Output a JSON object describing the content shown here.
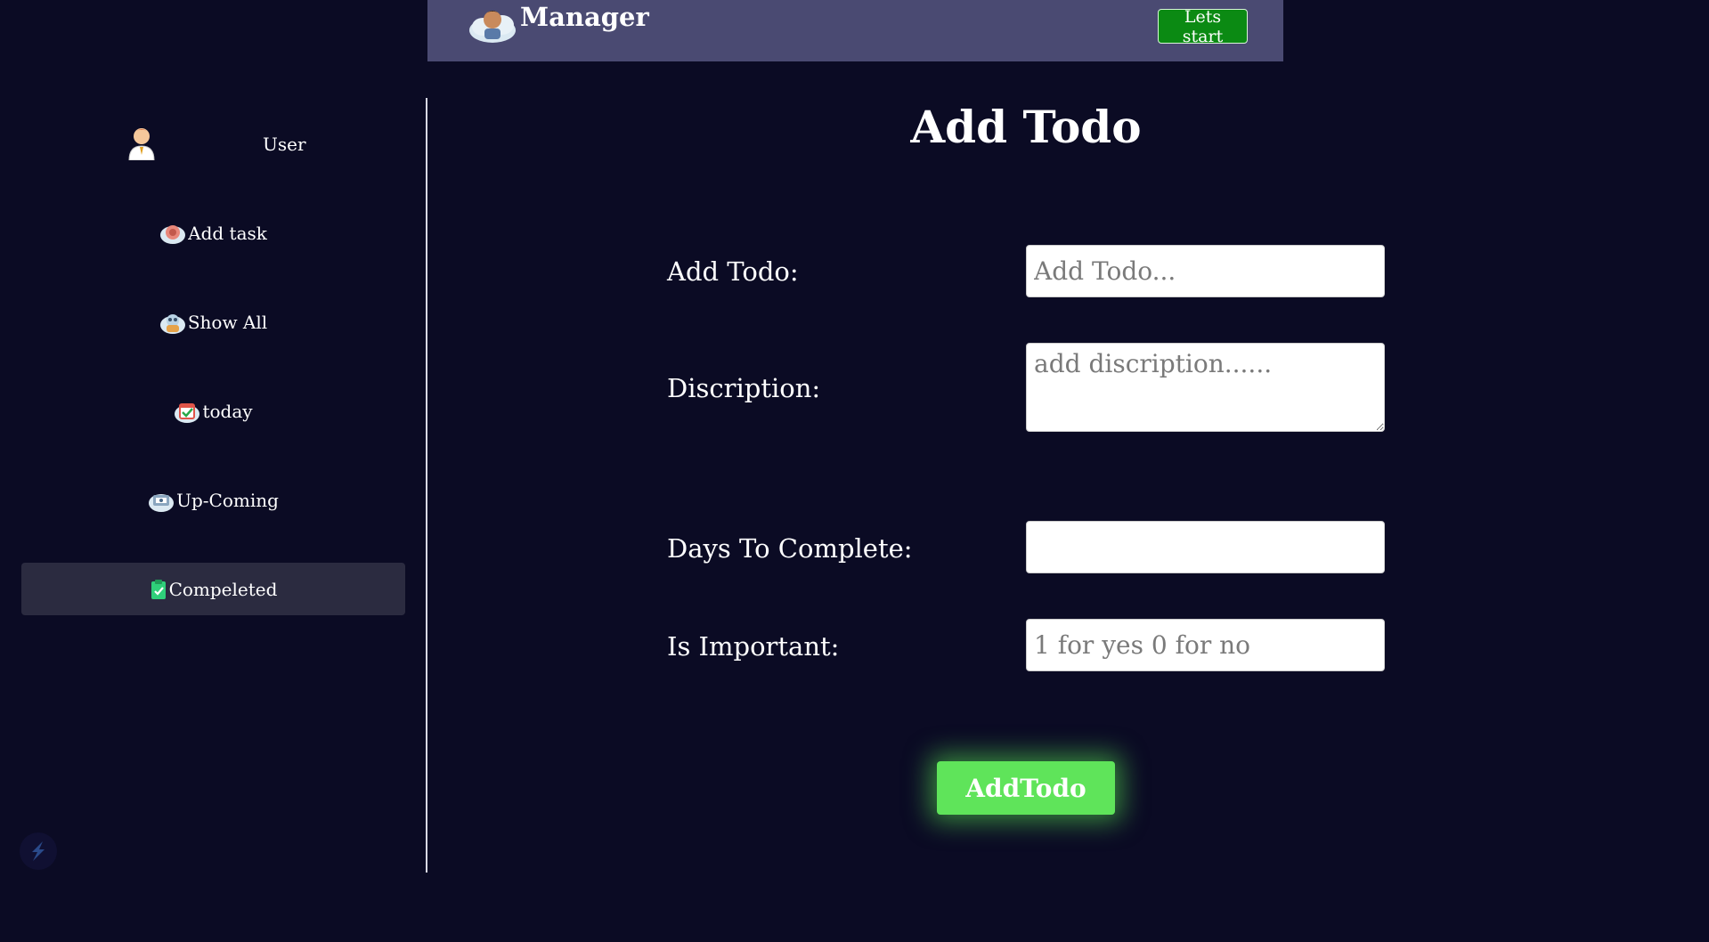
{
  "header": {
    "title": "Manager",
    "logo_icon": "manager-avatar-icon",
    "start_button": "Lets start"
  },
  "sidebar": {
    "user": {
      "name": "User",
      "icon": "user-avatar-icon"
    },
    "items": [
      {
        "label": "Add task",
        "icon": "add-task-icon",
        "active": false
      },
      {
        "label": "Show All",
        "icon": "show-all-icon",
        "active": false
      },
      {
        "label": "today",
        "icon": "today-calendar-icon",
        "active": false
      },
      {
        "label": "Up-Coming",
        "icon": "upcoming-icon",
        "active": false
      },
      {
        "label": "Compeleted",
        "icon": "completed-clipboard-icon",
        "active": true
      }
    ]
  },
  "main": {
    "title": "Add Todo",
    "fields": {
      "todo": {
        "label": "Add Todo:",
        "placeholder": "Add Todo...",
        "value": ""
      },
      "description": {
        "label": "Discription:",
        "placeholder": "add discription......",
        "value": ""
      },
      "days": {
        "label": "Days To Complete:",
        "placeholder": "",
        "value": ""
      },
      "important": {
        "label": "Is Important:",
        "placeholder": "1 for yes 0 for no",
        "value": ""
      }
    },
    "submit_label": "AddTodo"
  },
  "colors": {
    "background": "#0b0b24",
    "header": "#4a4a72",
    "start_button": "#0b8a13",
    "submit_button": "#5fe45a",
    "active_nav": "#2b2b40"
  }
}
